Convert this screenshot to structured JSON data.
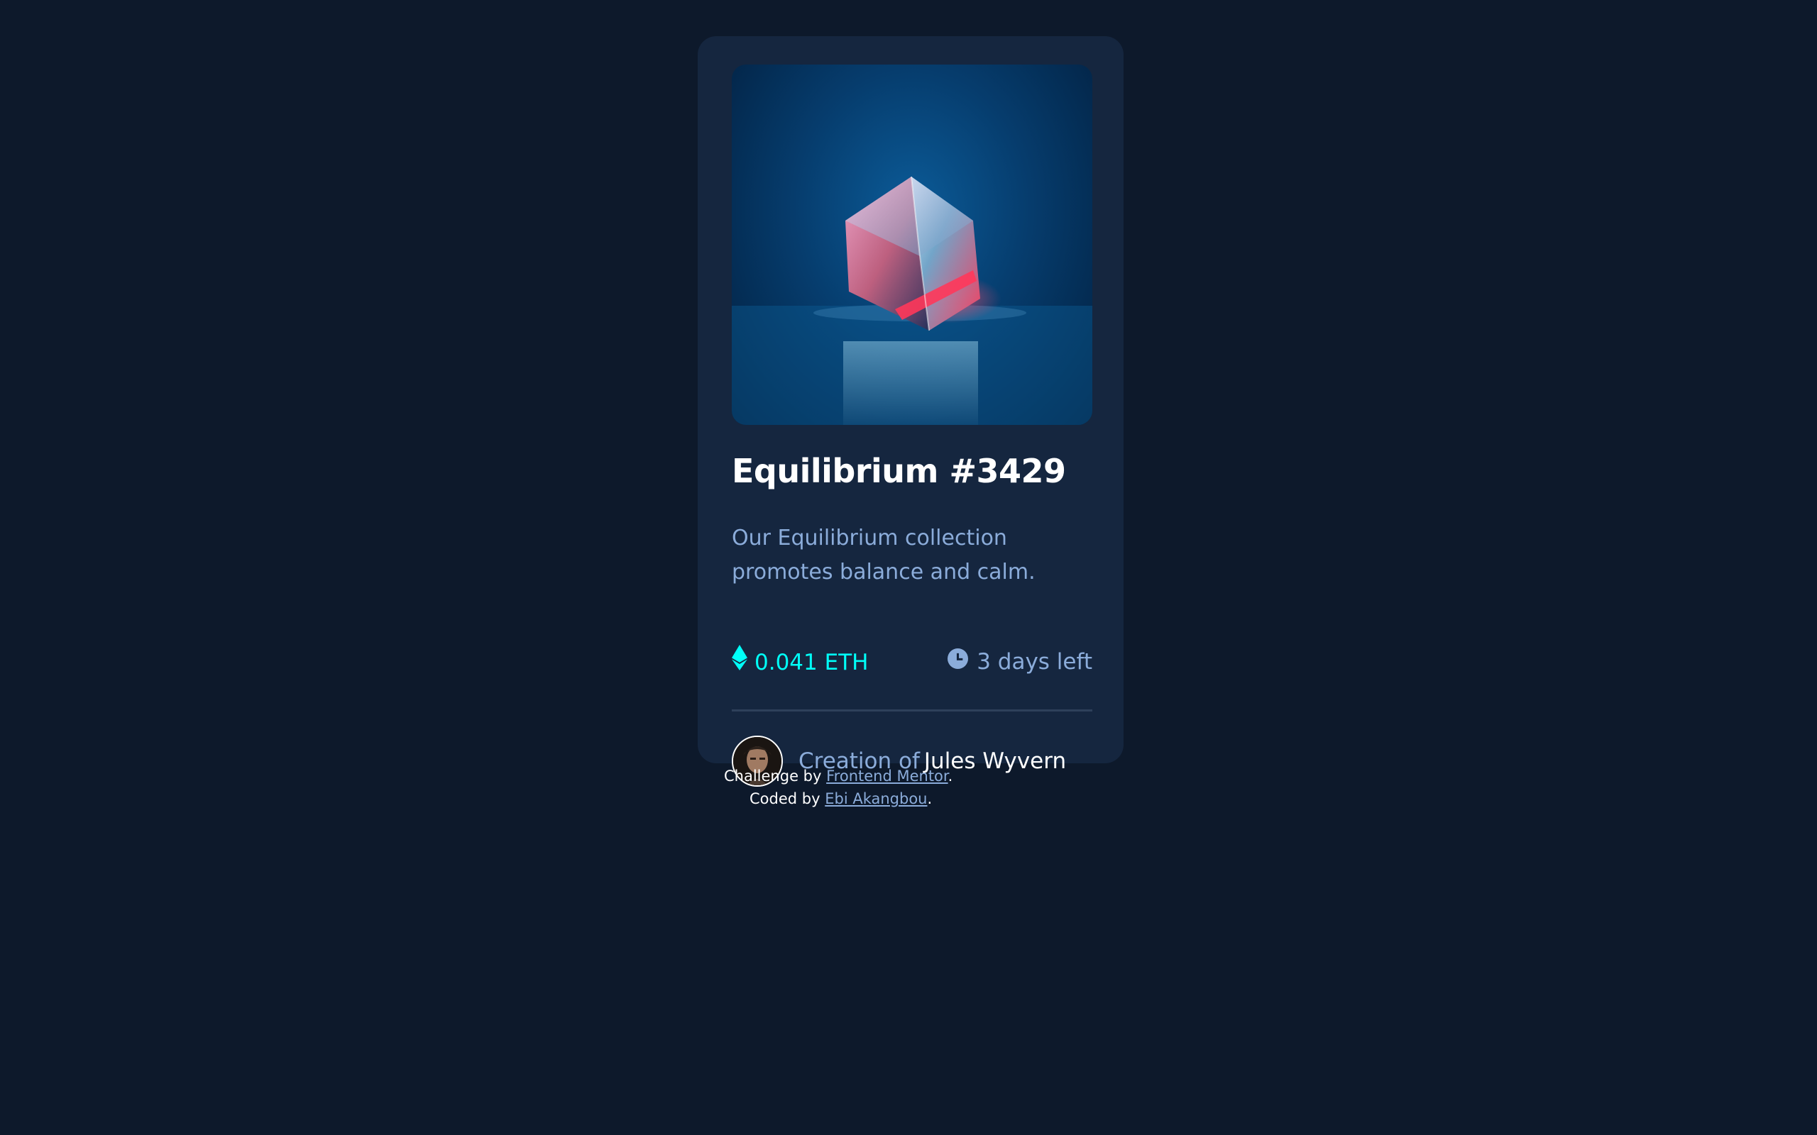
{
  "card": {
    "image_alt": "Equilibrium cube artwork",
    "title": "Equilibrium #3429",
    "description": "Our Equilibrium collection promotes balance and calm.",
    "price": "0.041 ETH",
    "time_left": "3 days left",
    "creator": {
      "prefix": "Creation of",
      "name": "Jules Wyvern"
    }
  },
  "footer": {
    "challenge_prefix": "Challenge by",
    "challenge_link": "Frontend Mentor",
    "challenge_suffix": ".",
    "coded_prefix": "Coded by",
    "coded_link": "Ebi Akangbou",
    "coded_suffix": "."
  },
  "icons": {
    "price": "ethereum-icon",
    "time": "clock-icon"
  },
  "colors": {
    "page_bg": "#0d192b",
    "card_bg": "#15263f",
    "accent_cyan": "#00fff8",
    "soft_blue": "#8bacda",
    "white": "#ffffff",
    "divider": "#2e405a"
  }
}
